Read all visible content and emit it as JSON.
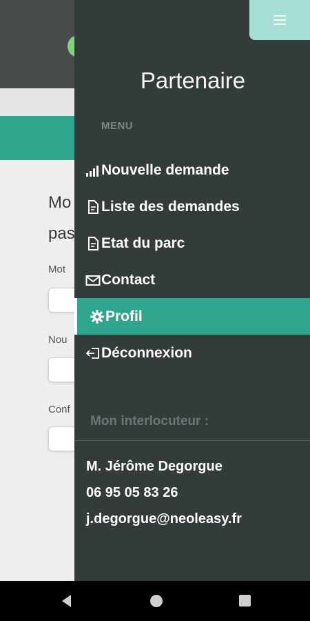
{
  "background_page": {
    "title_line1": "Mo",
    "title_line2": "pas",
    "label_1": "Mot",
    "label_2": "Nou",
    "label_3": "Conf"
  },
  "drawer": {
    "title": "Partenaire",
    "menu_header": "MENU",
    "items": [
      {
        "label": "Nouvelle demande",
        "icon": "signal-bars-icon",
        "active": false
      },
      {
        "label": "Liste des demandes",
        "icon": "document-icon",
        "active": false
      },
      {
        "label": "Etat du parc",
        "icon": "document-icon",
        "active": false
      },
      {
        "label": "Contact",
        "icon": "envelope-icon",
        "active": false
      },
      {
        "label": "Profil",
        "icon": "gear-icon",
        "active": true
      },
      {
        "label": "Déconnexion",
        "icon": "logout-icon",
        "active": false
      }
    ],
    "interlocutor_header": "Mon interlocuteur :",
    "contact": {
      "name": "M. Jérôme Degorgue",
      "phone": "06 95 05 83 26",
      "email": "j.degorgue@neoleasy.fr"
    }
  },
  "colors": {
    "drawer_bg": "#333b3b",
    "accent": "#2fa58e",
    "toggle_bg": "#a6dfd4"
  }
}
